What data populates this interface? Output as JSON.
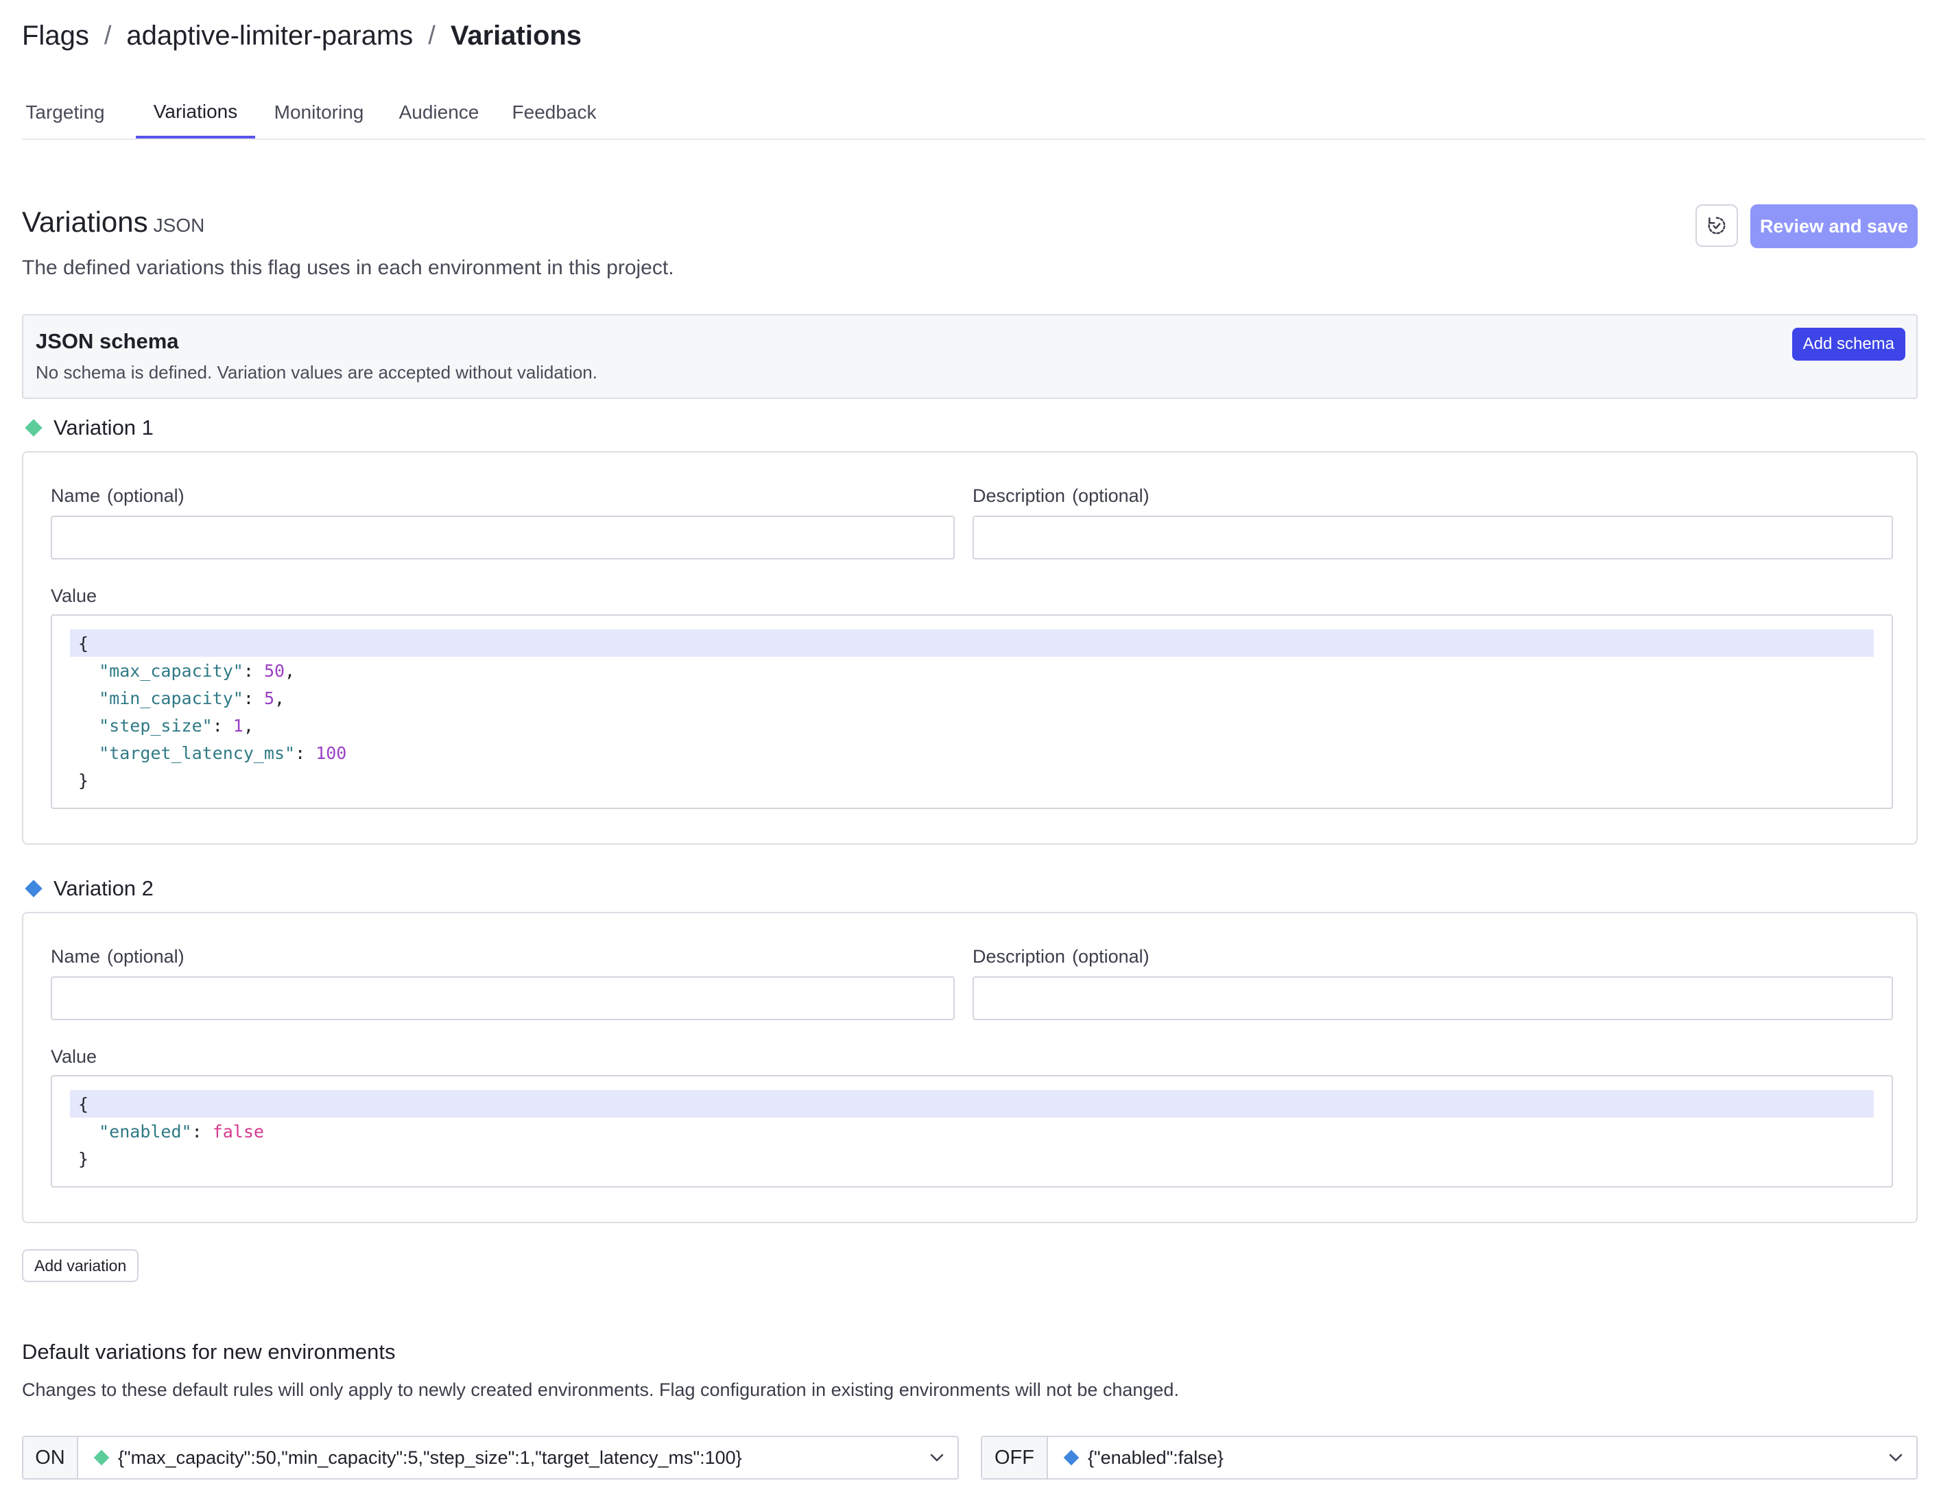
{
  "breadcrumb": {
    "root": "Flags",
    "flag": "adaptive-limiter-params",
    "current": "Variations",
    "separator": "/"
  },
  "tabs": [
    {
      "label": "Targeting",
      "active": false
    },
    {
      "label": "Variations",
      "active": true
    },
    {
      "label": "Monitoring",
      "active": false
    },
    {
      "label": "Audience",
      "active": false
    },
    {
      "label": "Feedback",
      "active": false
    }
  ],
  "section": {
    "title": "Variations",
    "type_tag": "JSON",
    "description": "The defined variations this flag uses in each environment in this project.",
    "history_icon": "history-icon",
    "review_label": "Review and save"
  },
  "schema": {
    "title": "JSON schema",
    "description": "No schema is defined. Variation values are accepted without validation.",
    "add_label": "Add schema"
  },
  "variations": [
    {
      "title": "Variation 1",
      "color": "#5ccc9a",
      "name_label": "Name",
      "name_optional": "(optional)",
      "name_value": "",
      "desc_label": "Description",
      "desc_optional": "(optional)",
      "desc_value": "",
      "value_label": "Value",
      "value_lines": [
        {
          "indent": "",
          "key": "",
          "sep": "",
          "val": "",
          "punct": "{",
          "vtype": ""
        },
        {
          "indent": "  ",
          "key": "\"max_capacity\"",
          "sep": ": ",
          "val": "50",
          "punct": ",",
          "vtype": "n"
        },
        {
          "indent": "  ",
          "key": "\"min_capacity\"",
          "sep": ": ",
          "val": "5",
          "punct": ",",
          "vtype": "n"
        },
        {
          "indent": "  ",
          "key": "\"step_size\"",
          "sep": ": ",
          "val": "1",
          "punct": ",",
          "vtype": "n"
        },
        {
          "indent": "  ",
          "key": "\"target_latency_ms\"",
          "sep": ": ",
          "val": "100",
          "punct": "",
          "vtype": "n"
        },
        {
          "indent": "",
          "key": "",
          "sep": "",
          "val": "",
          "punct": "}",
          "vtype": ""
        }
      ]
    },
    {
      "title": "Variation 2",
      "color": "#3f86de",
      "name_label": "Name",
      "name_optional": "(optional)",
      "name_value": "",
      "desc_label": "Description",
      "desc_optional": "(optional)",
      "desc_value": "",
      "value_label": "Value",
      "value_lines": [
        {
          "indent": "",
          "key": "",
          "sep": "",
          "val": "",
          "punct": "{",
          "vtype": ""
        },
        {
          "indent": "  ",
          "key": "\"enabled\"",
          "sep": ": ",
          "val": "false",
          "punct": "",
          "vtype": "b"
        },
        {
          "indent": "",
          "key": "",
          "sep": "",
          "val": "",
          "punct": "}",
          "vtype": ""
        }
      ]
    }
  ],
  "add_variation_label": "Add variation",
  "defaults": {
    "title": "Default variations for new environments",
    "description": "Changes to these default rules will only apply to newly created environments. Flag configuration in existing environments will not be changed.",
    "on": {
      "label": "ON",
      "value": "{\"max_capacity\":50,\"min_capacity\":5,\"step_size\":1,\"target_latency_ms\":100}",
      "color": "#5ccc9a"
    },
    "off": {
      "label": "OFF",
      "value": "{\"enabled\":false}",
      "color": "#3f86de"
    }
  },
  "colors": {
    "accent": "#5856e8",
    "primary_button": "#3d45e8",
    "review_button": "#8f96fa",
    "code_highlight": "#e5e8fc"
  }
}
